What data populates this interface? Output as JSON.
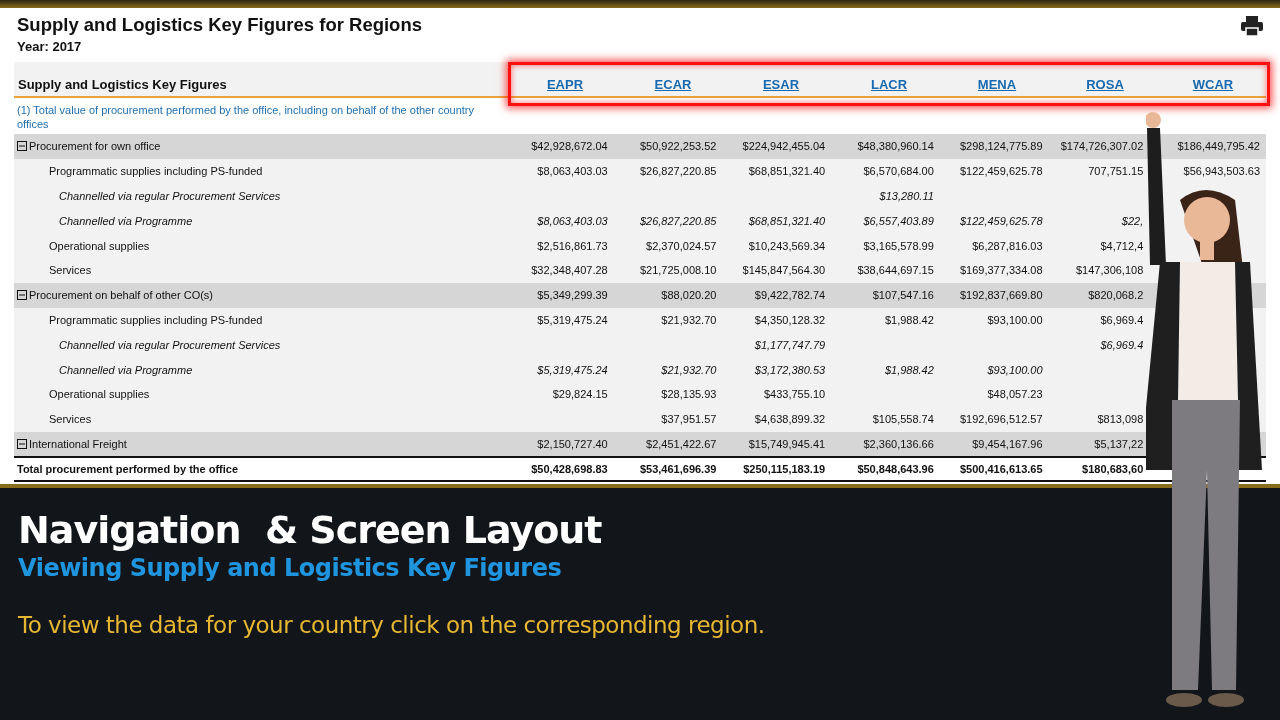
{
  "report": {
    "title": "Supply and Logistics Key Figures for Regions",
    "year": "Year: 2017"
  },
  "table": {
    "heading": "Supply and Logistics Key Figures",
    "regions_highlighted": true,
    "regions": [
      "EAPR",
      "ECAR",
      "ESAR",
      "LACR",
      "MENA",
      "ROSA",
      "WCAR"
    ],
    "footnote": "(1) Total value of procurement performed by the office, including on behalf of the other country offices",
    "rows": [
      {
        "kind": "group",
        "expanded": true,
        "label": "Procurement for own office",
        "cells": [
          {
            "text": "$42,928,672.04"
          },
          {
            "text": "$50,922,253.52"
          },
          {
            "text": "$224,942,455.04"
          },
          {
            "text": "$48,380,960.14"
          },
          {
            "text": "$298,124,775.89"
          },
          {
            "text": "$174,726,307.02"
          },
          {
            "text": "$186,449,795.42"
          }
        ]
      },
      {
        "kind": "item",
        "label": "Programmatic supplies including PS-funded",
        "cells": [
          {
            "text": "$8,063,403.03"
          },
          {
            "text": "$26,827,220.85"
          },
          {
            "text": "$68,851,321.40"
          },
          {
            "text": "$6,570,684.00"
          },
          {
            "text": "$122,459,625.78"
          },
          {
            "text": "707,751.15"
          },
          {
            "text": "$56,943,503.63"
          }
        ]
      },
      {
        "kind": "sub",
        "label": "Channelled via regular Procurement Services",
        "cells": [
          {},
          {},
          {},
          {
            "text": "$13,280.11"
          },
          {},
          {},
          {}
        ]
      },
      {
        "kind": "sub",
        "label": "Channelled via Programme",
        "cells": [
          {
            "text": "$8,063,403.03"
          },
          {
            "text": "$26,827,220.85"
          },
          {
            "text": "$68,851,321.40"
          },
          {
            "text": "$6,557,403.89"
          },
          {
            "text": "$122,459,625.78"
          },
          {
            "text": "$22,"
          },
          {}
        ]
      },
      {
        "kind": "item",
        "label": "Operational supplies",
        "cells": [
          {
            "text": "$2,516,861.73"
          },
          {
            "text": "$2,370,024.57"
          },
          {
            "text": "$10,243,569.34"
          },
          {
            "text": "$3,165,578.99"
          },
          {
            "text": "$6,287,816.03"
          },
          {
            "text": "$4,712,4"
          },
          {}
        ]
      },
      {
        "kind": "item",
        "label": "Services",
        "cells": [
          {
            "text": "$32,348,407.28"
          },
          {
            "text": "$21,725,008.10"
          },
          {
            "text": "$145,847,564.30"
          },
          {
            "text": "$38,644,697.15"
          },
          {
            "text": "$169,377,334.08"
          },
          {
            "text": "$147,306,108"
          },
          {}
        ]
      },
      {
        "kind": "group",
        "expanded": true,
        "label": "Procurement on behalf of other CO(s)",
        "cells": [
          {
            "text": "$5,349,299.39"
          },
          {
            "text": "$88,020.20"
          },
          {
            "text": "$9,422,782.74"
          },
          {
            "text": "$107,547.16"
          },
          {
            "text": "$192,837,669.80"
          },
          {
            "text": "$820,068.2"
          },
          {}
        ]
      },
      {
        "kind": "item",
        "label": "Programmatic supplies including PS-funded",
        "cells": [
          {
            "text": "$5,319,475.24"
          },
          {
            "text": "$21,932.70"
          },
          {
            "text": "$4,350,128.32"
          },
          {
            "text": "$1,988.42"
          },
          {
            "text": "$93,100.00"
          },
          {
            "text": "$6,969.4"
          },
          {}
        ]
      },
      {
        "kind": "sub",
        "label": "Channelled via regular Procurement Services",
        "cells": [
          {},
          {},
          {
            "text": "$1,177,747.79"
          },
          {},
          {},
          {
            "text": "$6,969.4"
          },
          {}
        ]
      },
      {
        "kind": "sub",
        "label": "Channelled via Programme",
        "cells": [
          {
            "text": "$5,319,475.24"
          },
          {
            "text": "$21,932.70"
          },
          {
            "text": "$3,172,380.53"
          },
          {
            "text": "$1,988.42"
          },
          {
            "text": "$93,100.00"
          },
          {},
          {}
        ]
      },
      {
        "kind": "item",
        "label": "Operational supplies",
        "cells": [
          {
            "text": "$29,824.15"
          },
          {
            "text": "$28,135.93"
          },
          {
            "text": "$433,755.10"
          },
          {},
          {
            "text": "$48,057.23"
          },
          {},
          {}
        ]
      },
      {
        "kind": "item",
        "label": "Services",
        "cells": [
          {},
          {
            "text": "$37,951.57"
          },
          {
            "text": "$4,638,899.32"
          },
          {
            "text": "$105,558.74"
          },
          {
            "text": "$192,696,512.57"
          },
          {
            "text": "$813,098"
          },
          {}
        ]
      },
      {
        "kind": "group",
        "expanded": true,
        "label": "International Freight",
        "cells": [
          {
            "text": "$2,150,727.40"
          },
          {
            "text": "$2,451,422.67"
          },
          {
            "text": "$15,749,945.41"
          },
          {
            "text": "$2,360,136.66"
          },
          {
            "text": "$9,454,167.96"
          },
          {
            "text": "$5,137,22"
          },
          {}
        ]
      },
      {
        "kind": "total",
        "label": "Total procurement performed by the office",
        "cells": [
          {
            "text": "$50,428,698.83"
          },
          {
            "text": "$53,461,696.39"
          },
          {
            "text": "$250,115,183.19"
          },
          {
            "text": "$50,848,643.96"
          },
          {
            "text": "$500,416,613.65"
          },
          {
            "text": "$180,683,60"
          },
          {}
        ]
      }
    ]
  },
  "caption": {
    "title": "Navigation  & Screen Layout",
    "subtitle": "Viewing Supply and Logistics Key Figures",
    "text": "To view the data for your country click on the corresponding region."
  }
}
